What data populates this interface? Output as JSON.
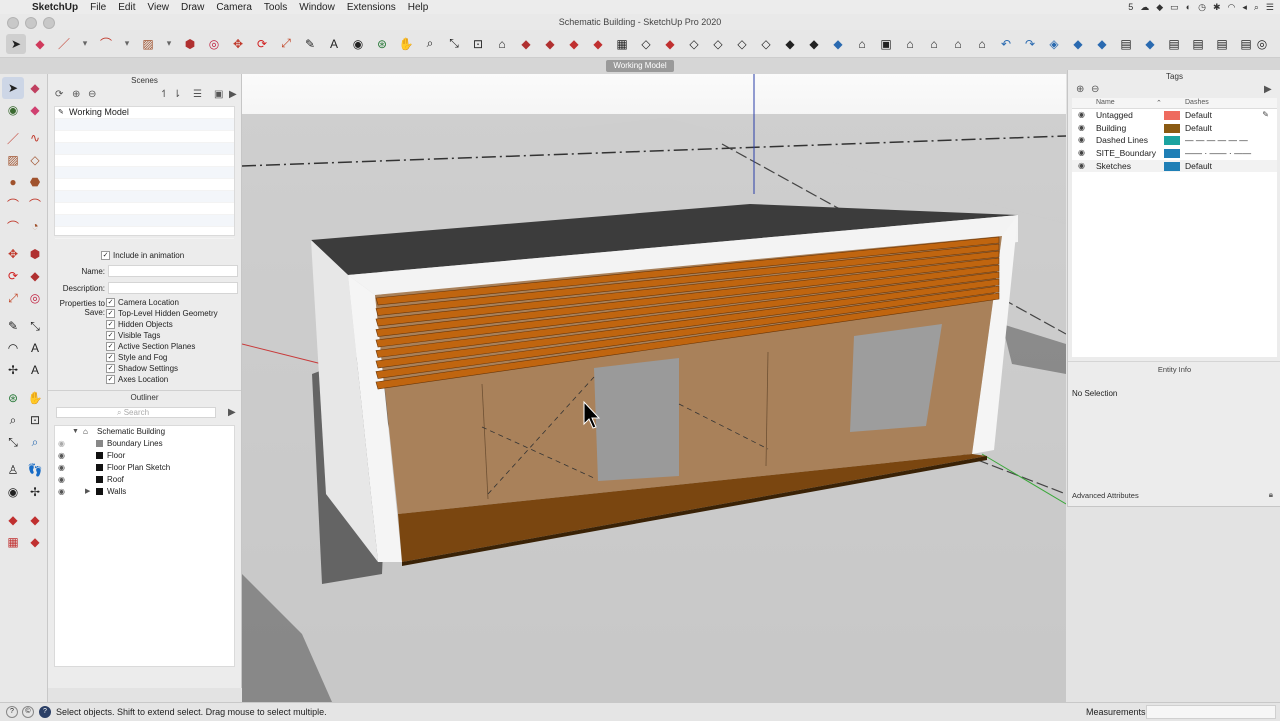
{
  "menubar": {
    "app": "SketchUp",
    "items": [
      "File",
      "Edit",
      "View",
      "Draw",
      "Camera",
      "Tools",
      "Window",
      "Extensions",
      "Help"
    ],
    "status_badge": "5"
  },
  "window": {
    "title": "Schematic Building - SketchUp Pro 2020"
  },
  "scene_tab": "Working Model",
  "scenes_panel": {
    "title": "Scenes",
    "scenes": [
      "Working Model"
    ],
    "include_animation": "Include in animation",
    "name_label": "Name:",
    "description_label": "Description:",
    "properties_label": "Properties to Save:",
    "properties": [
      "Camera Location",
      "Top-Level Hidden Geometry",
      "Hidden Objects",
      "Visible Tags",
      "Active Section Planes",
      "Style and Fog",
      "Shadow Settings",
      "Axes Location"
    ]
  },
  "outliner": {
    "title": "Outliner",
    "search_placeholder": "Search",
    "root": "Schematic Building",
    "items": [
      "Boundary Lines",
      "Floor",
      "Floor Plan Sketch",
      "Roof",
      "Walls"
    ]
  },
  "tags_panel": {
    "title": "Tags",
    "col_name": "Name",
    "col_dashes": "Dashes",
    "rows": [
      {
        "name": "Untagged",
        "color": "#ee6b5f",
        "dashes": "Default"
      },
      {
        "name": "Building",
        "color": "#8a5a12",
        "dashes": "Default"
      },
      {
        "name": "Dashed Lines",
        "color": "#1aa3a0",
        "dashes": "— — — — — —"
      },
      {
        "name": "SITE_Boundary",
        "color": "#1f7fb6",
        "dashes": "—— · —— · ——"
      },
      {
        "name": "Sketches",
        "color": "#1f7fb6",
        "dashes": "Default"
      }
    ]
  },
  "entity_info": {
    "title": "Entity Info",
    "selection": "No Selection",
    "advanced": "Advanced Attributes"
  },
  "statusbar": {
    "message": "Select objects. Shift to extend select. Drag mouse to select multiple.",
    "measurements_label": "Measurements"
  }
}
